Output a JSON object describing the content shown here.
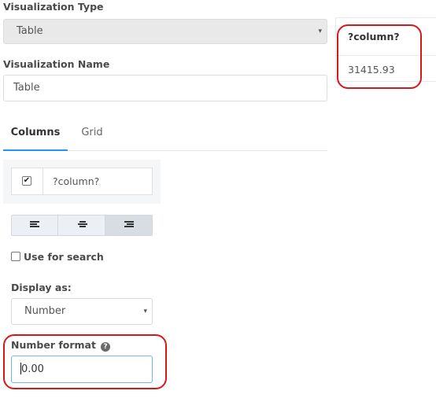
{
  "visualization_type": {
    "label": "Visualization Type",
    "value": "Table",
    "caret": "▾"
  },
  "visualization_name": {
    "label": "Visualization Name",
    "value": "Table"
  },
  "tabs": [
    {
      "label": "Columns",
      "active": true
    },
    {
      "label": "Grid",
      "active": false
    }
  ],
  "column": {
    "checked_mark": "✔",
    "name": "?column?"
  },
  "alignment": {
    "options": [
      "align-left",
      "align-center",
      "align-right"
    ],
    "selected": "align-right"
  },
  "use_for_search": {
    "label": "Use for search",
    "checked": false
  },
  "display_as": {
    "label": "Display as:",
    "value": "Number",
    "caret": "▾"
  },
  "number_format": {
    "label": "Number format",
    "help_glyph": "?",
    "value": "0.00"
  },
  "preview_table": {
    "header": "?column?",
    "rows": [
      "31415.93"
    ]
  },
  "highlight_color": "#d81818",
  "accent_color": "#2196f3"
}
